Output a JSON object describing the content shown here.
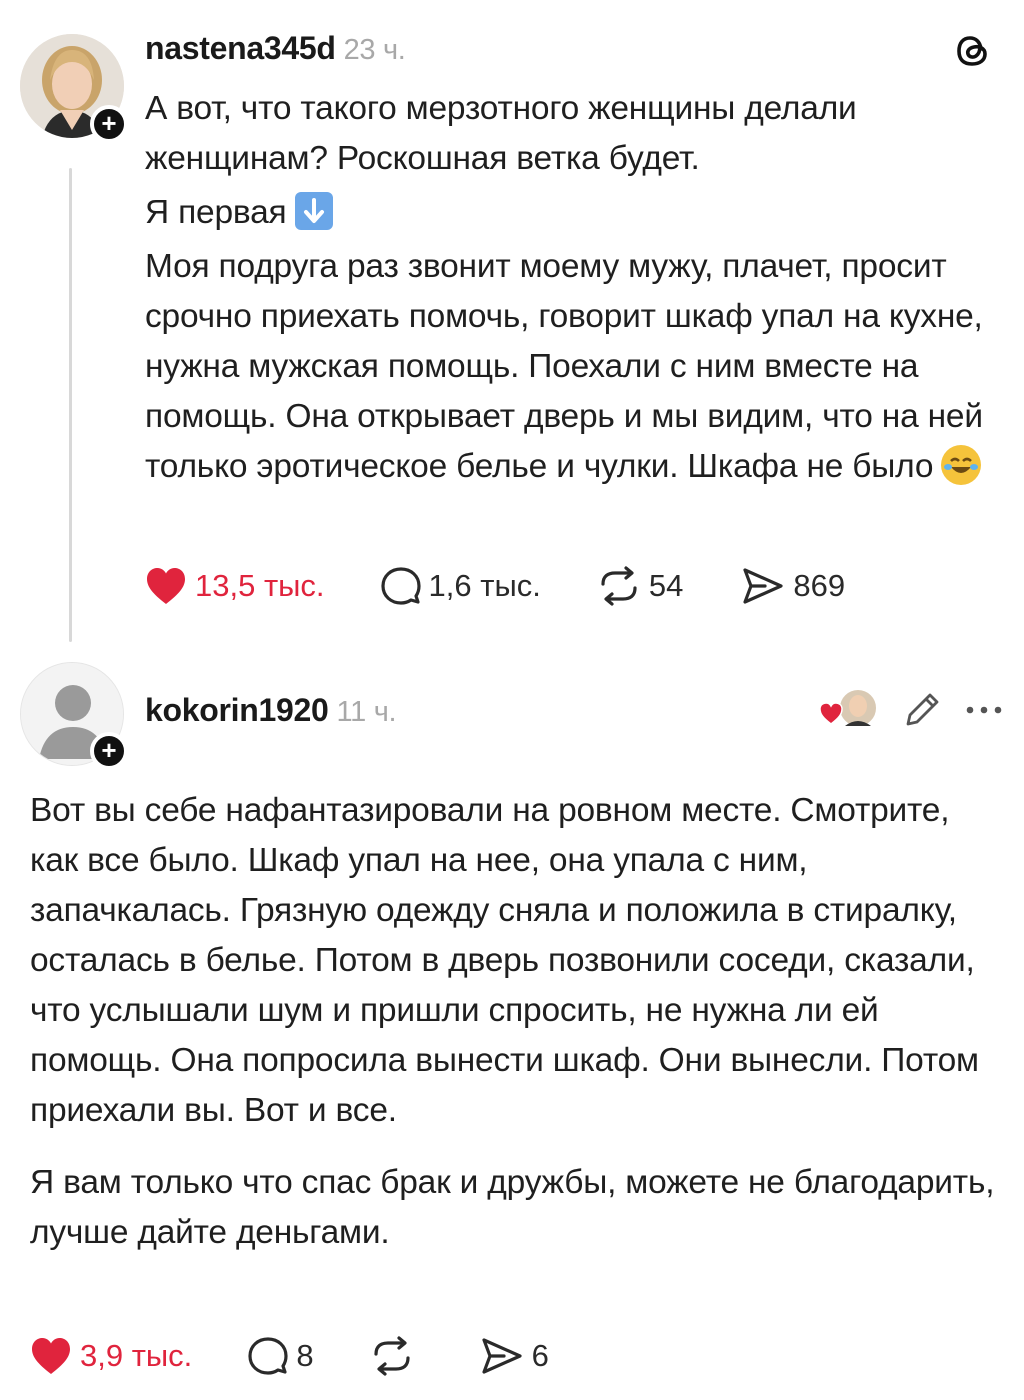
{
  "post1": {
    "username": "nastena345d",
    "time": "23 ч.",
    "paragraphs": [
      "А вот, что такого мерзотного женщины делали женщинам? Роскошная ветка будет.",
      "Я первая",
      "Моя подруга раз звонит моему мужу, плачет, просит срочно приехать помочь, говорит шкаф упал на кухне, нужна мужская помощь. Поехали с ним вместе на помощь. Она открывает дверь и мы видим, что на ней только эротическое белье и чулки. Шкафа не было"
    ],
    "emojis": {
      "after_second": "arrow-down-emoji",
      "after_third": "laughing-emoji"
    },
    "stats": {
      "likes": "13,5 тыс.",
      "comments": "1,6 тыс.",
      "reposts": "54",
      "shares": "869"
    }
  },
  "post2": {
    "username": "kokorin1920",
    "time": "11 ч.",
    "paragraphs": [
      "Вот вы себе нафантазировали на ровном месте. Смотрите, как все было. Шкаф упал на нее, она упала с ним, запачкалась. Грязную одежду сняла и положила в стиралку, осталась в белье. Потом в дверь позвонили соседи, сказали, что услышали шум и пришли спросить, не нужна ли ей помощь. Она попросила вынести шкаф. Они вынесли. Потом приехали вы. Вот и все.",
      "Я вам только что спас брак и дружбы, можете не благодарить, лучше дайте деньгами."
    ],
    "stats": {
      "likes": "3,9 тыс.",
      "comments": "8",
      "reposts": "",
      "shares": "6"
    }
  },
  "icons": [
    "threads-logo-icon",
    "heart-icon",
    "comment-icon",
    "repost-icon",
    "share-icon",
    "edit-icon",
    "more-icon",
    "follow-plus-icon"
  ],
  "colors": {
    "like": "#e0243d",
    "muted": "#a8a8a8",
    "text": "#1f1f1f"
  }
}
